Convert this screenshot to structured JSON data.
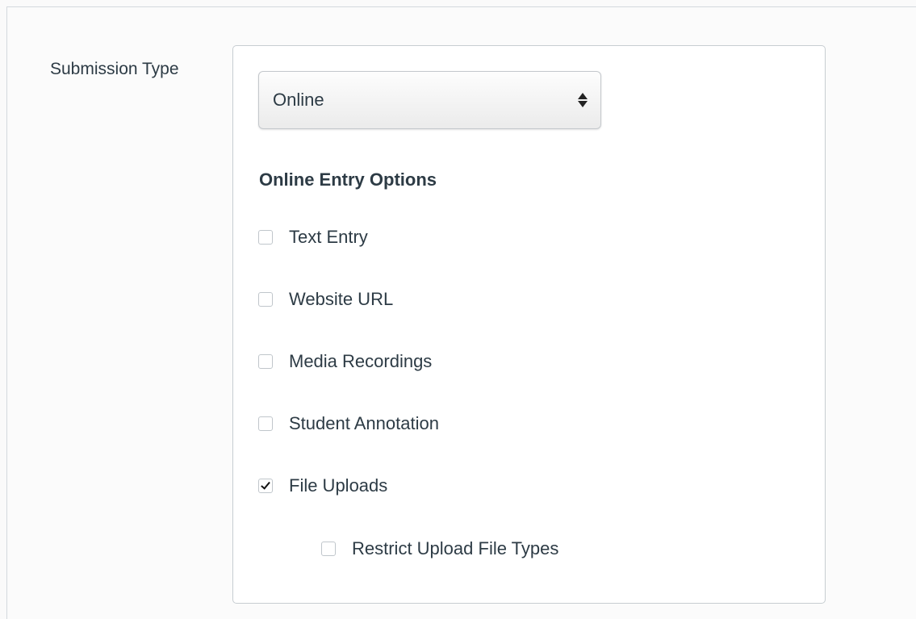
{
  "form": {
    "label": "Submission Type",
    "select": {
      "value": "Online"
    },
    "online_entry": {
      "title": "Online Entry Options",
      "options": [
        {
          "label": "Text Entry",
          "checked": false
        },
        {
          "label": "Website URL",
          "checked": false
        },
        {
          "label": "Media Recordings",
          "checked": false
        },
        {
          "label": "Student Annotation",
          "checked": false
        },
        {
          "label": "File Uploads",
          "checked": true
        }
      ],
      "sub_option": {
        "label": "Restrict Upload File Types",
        "checked": false
      }
    }
  },
  "icons": {
    "select_arrow": "updown-arrow-icon",
    "checkbox": "checkbox-icon",
    "checkmark": "check-icon"
  }
}
